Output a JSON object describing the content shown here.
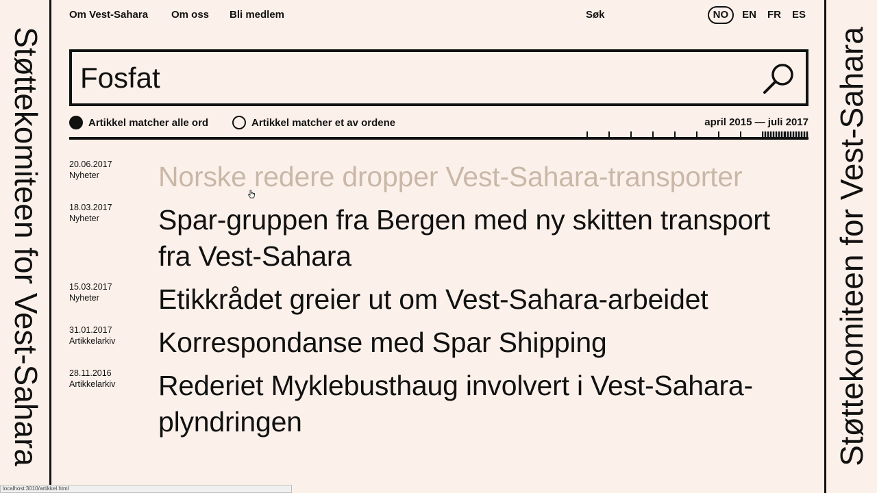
{
  "brand": {
    "left_text": "Støttekomiteen for Vest-Sahara",
    "right_text": "Støttekomiteen for Vest-Sahara"
  },
  "nav": {
    "items": [
      "Om Vest-Sahara",
      "Om oss",
      "Bli medlem"
    ],
    "search_label": "Søk"
  },
  "languages": {
    "items": [
      "NO",
      "EN",
      "FR",
      "ES"
    ],
    "active": "NO"
  },
  "search": {
    "value": "Fosfat",
    "icon": "search-icon"
  },
  "filters": {
    "match_all": "Artikkel matcher alle ord",
    "match_any": "Artikkel matcher et av ordene",
    "selected": "match_all",
    "date_range": "april 2015 — juli 2017"
  },
  "results": [
    {
      "date": "20.06.2017",
      "category": "Nyheter",
      "title": "Norske redere dropper Vest-Sahara-transporter",
      "faded": true
    },
    {
      "date": "18.03.2017",
      "category": "Nyheter",
      "title": "Spar-gruppen fra Bergen med ny skitten transport fra Vest-Sahara",
      "faded": false
    },
    {
      "date": "15.03.2017",
      "category": "Nyheter",
      "title": "Etikkrådet greier ut om Vest-Sahara-arbeidet",
      "faded": false
    },
    {
      "date": "31.01.2017",
      "category": "Artikkelarkiv",
      "title": "Korrespondanse med Spar Shipping",
      "faded": false
    },
    {
      "date": "28.11.2016",
      "category": "Artikkelarkiv",
      "title": "Rederiet Myklebusthaug involvert i Vest-Sahara-plyndringen",
      "faded": false
    }
  ],
  "statusbar": {
    "url": "localhost:3010/artikkel.html"
  }
}
